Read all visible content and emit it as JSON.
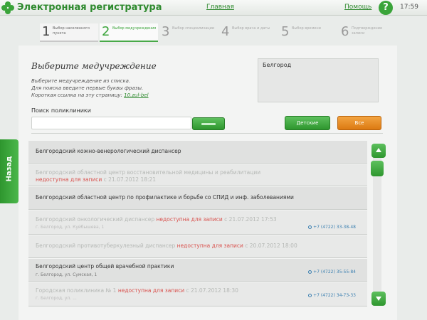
{
  "header": {
    "title": "Электронная регистратура",
    "home_link": "Главная",
    "help_link": "Помощь",
    "help_icon": "?",
    "clock": "17:59"
  },
  "steps": [
    {
      "num": "1",
      "label": "Выбор населенного пункта",
      "state": "done"
    },
    {
      "num": "2",
      "label": "Выбор медучреждения",
      "state": "active"
    },
    {
      "num": "3",
      "label": "Выбор специализации",
      "state": "upcoming"
    },
    {
      "num": "4",
      "label": "Выбор врача и даты",
      "state": "upcoming"
    },
    {
      "num": "5",
      "label": "Выбор времени",
      "state": "upcoming"
    },
    {
      "num": "6",
      "label": "Подтверждение записи",
      "state": "upcoming"
    }
  ],
  "main": {
    "title": "Выберите медучреждение",
    "instructions": [
      "Выберите медучреждение из списка.",
      "Для поиска введите первые буквы фразы.",
      "Короткая ссылка на эту страницу:"
    ],
    "short_link": "10.zul-bel",
    "city": "Белгород",
    "search_label": "Поиск поликлиники",
    "search_value": "",
    "btn_green": "Детские",
    "btn_orange": "Все",
    "back_label": "Назад"
  },
  "list": [
    {
      "name": "Белгородский кожно-венерологический диспансер",
      "status": "",
      "address": "",
      "phone": "",
      "muted": false
    },
    {
      "name": "Белгородский областной центр восстановительной медицины и реабилитации",
      "status": "недоступна для записи",
      "status_extra": " с 21.07.2012 18:21",
      "address": "",
      "phone": "",
      "muted": true
    },
    {
      "name": "Белгородский областной центр по профилактике и борьбе со СПИД и инф. заболеваниями",
      "status": "",
      "address": "",
      "phone": "",
      "muted": false
    },
    {
      "name": "Белгородский онкологический диспансер",
      "status": "недоступна для записи",
      "status_extra": " с 21.07.2012 17:53",
      "address": "г. Белгород, ул. Куйбышева, 1",
      "phone": "+7 (4722) 33-38-48",
      "muted": true
    },
    {
      "name": "Белгородский противотуберкулезный диспансер",
      "status": "недоступна для записи",
      "status_extra": " с 20.07.2012 18:00",
      "address": "",
      "phone": "",
      "muted": true
    },
    {
      "name": "Белгородский центр общей врачебной практики",
      "status": "",
      "address": "г. Белгород, ул. Сумская, 1",
      "phone": "+7 (4722) 35-55-84",
      "muted": false
    },
    {
      "name": "Городская поликлиника № 1",
      "status": "недоступна для записи",
      "status_extra": " с 21.07.2012 18:30",
      "address": "г. Белгород, ул. ...",
      "phone": "+7 (4722) 34-73-33",
      "muted": true
    }
  ]
}
